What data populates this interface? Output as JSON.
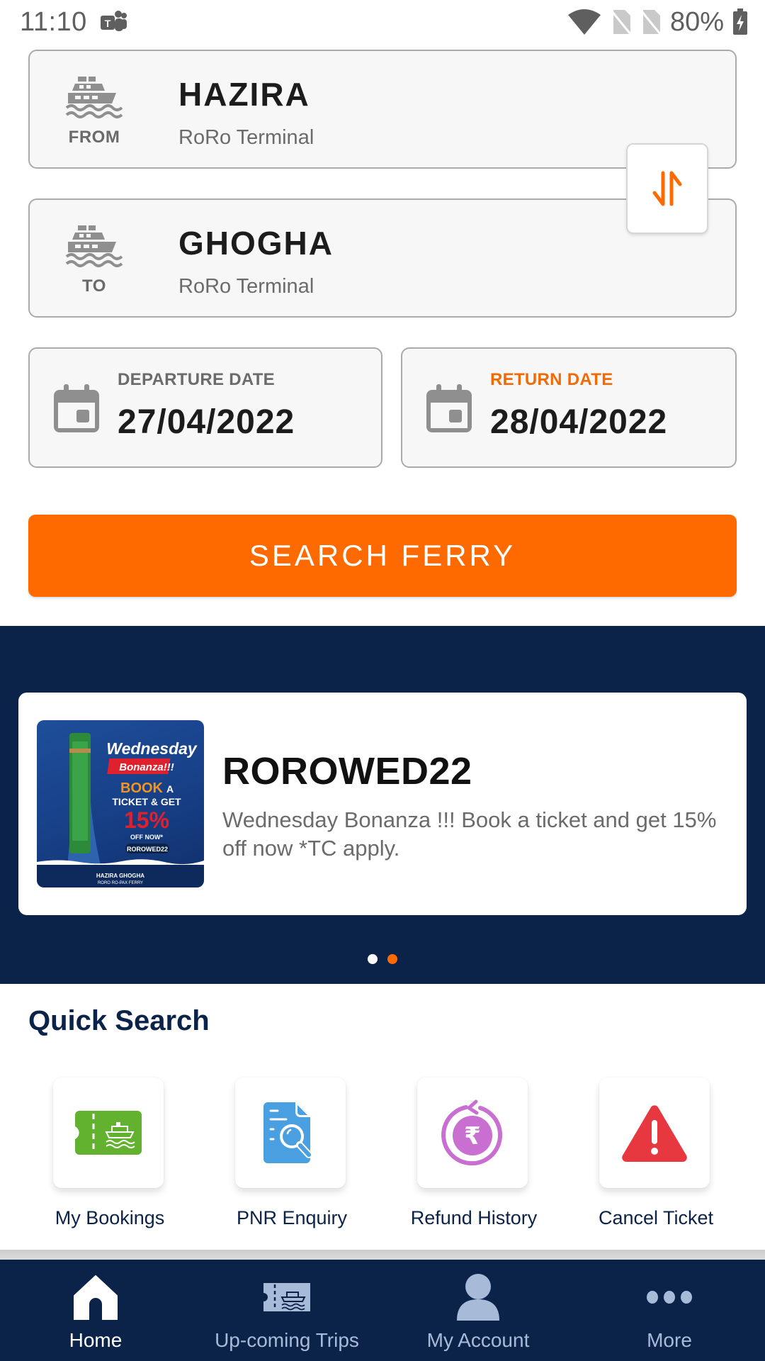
{
  "status_bar": {
    "time": "11:10",
    "notification_icon": "teams-icon",
    "icons": [
      "wifi-icon",
      "no-sim-icon",
      "no-sim-icon",
      "battery-charging-icon"
    ],
    "battery": "80%"
  },
  "route": {
    "from": {
      "role": "FROM",
      "city": "HAZIRA",
      "terminal": "RoRo Terminal",
      "icon": "ship-icon"
    },
    "to": {
      "role": "TO",
      "city": "GHOGHA",
      "terminal": "RoRo Terminal",
      "icon": "ship-icon"
    },
    "swap_icon": "swap-vertical-icon"
  },
  "dates": {
    "departure": {
      "label": "DEPARTURE DATE",
      "value": "27/04/2022",
      "icon": "calendar-icon"
    },
    "return": {
      "label": "RETURN DATE",
      "value": "28/04/2022",
      "icon": "calendar-icon"
    }
  },
  "search_button": {
    "label": "SEARCH FERRY"
  },
  "promo": {
    "image": {
      "headline": "Wednesday",
      "tagline": "Bonanza!!!",
      "book_word": "BOOK",
      "book_rest": "A",
      "line2": "TICKET & GET",
      "percent": "15%",
      "off": "OFF NOW*",
      "code": "ROROWED22",
      "brand": "HAZIRA GHOGHA",
      "brand_sub": "RORO RO-PAX FERRY"
    },
    "code": "ROROWED22",
    "description": "Wednesday Bonanza !!! Book a ticket and get 15% off now *TC apply.",
    "pagination": {
      "total": 2,
      "active_index": 1
    }
  },
  "quick_search": {
    "title": "Quick Search",
    "items": [
      {
        "label": "My Bookings",
        "icon": "ferry-ticket-icon",
        "color": "#62b22f"
      },
      {
        "label": "PNR Enquiry",
        "icon": "document-search-icon",
        "color": "#4a9fe0"
      },
      {
        "label": "Refund History",
        "icon": "rupee-refund-icon",
        "color": "#c86fd1"
      },
      {
        "label": "Cancel Ticket",
        "icon": "warning-icon",
        "color": "#e8383f"
      }
    ]
  },
  "bottom_nav": {
    "items": [
      {
        "label": "Home",
        "icon": "home-icon",
        "active": true
      },
      {
        "label": "Up-coming Trips",
        "icon": "ferry-ticket-icon",
        "active": false
      },
      {
        "label": "My Account",
        "icon": "user-icon",
        "active": false
      },
      {
        "label": "More",
        "icon": "more-dots-icon",
        "active": false
      }
    ]
  },
  "colors": {
    "accent": "#ff6a00",
    "navy": "#0c2349",
    "nav_inactive": "#a7bbd9",
    "card_border": "#aaaaaa"
  }
}
